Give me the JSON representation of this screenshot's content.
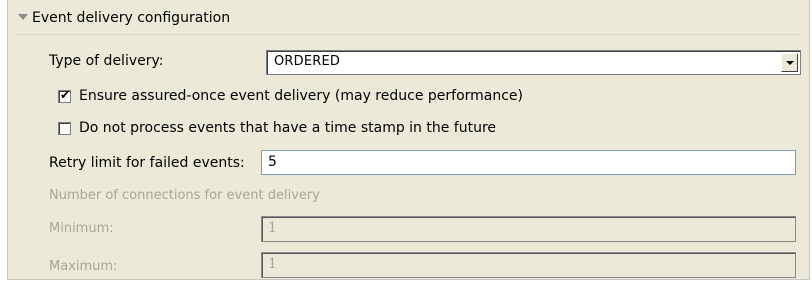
{
  "section": {
    "title": "Event delivery configuration"
  },
  "delivery_type": {
    "label": "Type of delivery:",
    "value": "ORDERED"
  },
  "assured_once": {
    "label": "Ensure assured-once event delivery (may reduce performance)",
    "checked": true,
    "check_glyph": "✔"
  },
  "future_timestamp": {
    "label": "Do not process events that have a time stamp in the future",
    "checked": false
  },
  "retry": {
    "label": "Retry limit for failed events:",
    "value": "5"
  },
  "connections": {
    "heading": "Number of connections for event delivery",
    "minimum_label": "Minimum:",
    "minimum_value": "1",
    "maximum_label": "Maximum:",
    "maximum_value": "1"
  }
}
